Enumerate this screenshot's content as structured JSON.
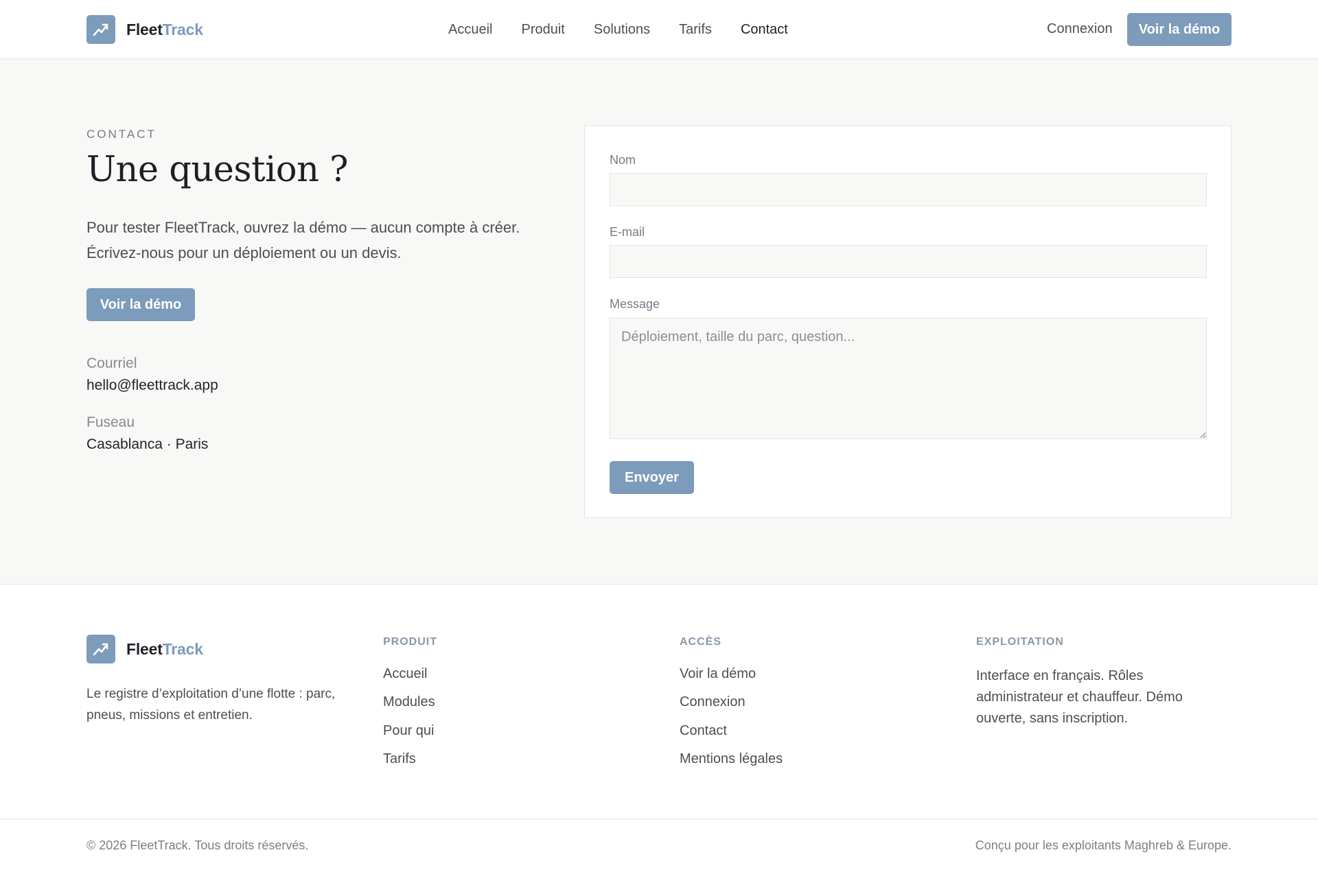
{
  "brand": {
    "name_primary": "Fleet",
    "name_accent": "Track",
    "logo_icon": "trend-line-icon"
  },
  "nav": {
    "items": [
      {
        "label": "Accueil"
      },
      {
        "label": "Produit"
      },
      {
        "label": "Solutions"
      },
      {
        "label": "Tarifs"
      },
      {
        "label": "Contact",
        "active": true
      }
    ],
    "login_label": "Connexion",
    "demo_label": "Voir la démo"
  },
  "hero": {
    "eyebrow": "CONTACT",
    "title": "Une question ?",
    "lead": "Pour tester FleetTrack, ouvrez la démo — aucun compte à créer. Écrivez-nous pour un déploiement ou un devis.",
    "demo_label": "Voir la démo",
    "email_label": "Courriel",
    "email_value": "hello@fleettrack.app",
    "timezone_label": "Fuseau",
    "timezone_value": "Casablanca · Paris"
  },
  "form": {
    "name_label": "Nom",
    "name_value": "",
    "email_label": "E-mail",
    "email_value": "",
    "message_label": "Message",
    "message_placeholder": "Déploiement, taille du parc, question...",
    "submit_label": "Envoyer"
  },
  "footer": {
    "description": "Le registre d’exploitation d’une flotte : parc, pneus, missions et entretien.",
    "columns": [
      {
        "heading": "PRODUIT",
        "links": [
          "Accueil",
          "Modules",
          "Pour qui",
          "Tarifs"
        ]
      },
      {
        "heading": "ACCÈS",
        "links": [
          "Voir la démo",
          "Connexion",
          "Contact",
          "Mentions légales"
        ]
      },
      {
        "heading": "EXPLOITATION",
        "text": "Interface en français. Rôles administrateur et chauffeur. Démo ouverte, sans inscription."
      }
    ],
    "copyright": "© 2026 FleetTrack. Tous droits réservés.",
    "tagline": "Conçu pour les exploitants Maghreb & Europe."
  },
  "colors": {
    "accent": "#7d9bbb",
    "text": "#1c2024",
    "muted": "#767c82",
    "background": "#f8f8f6"
  }
}
